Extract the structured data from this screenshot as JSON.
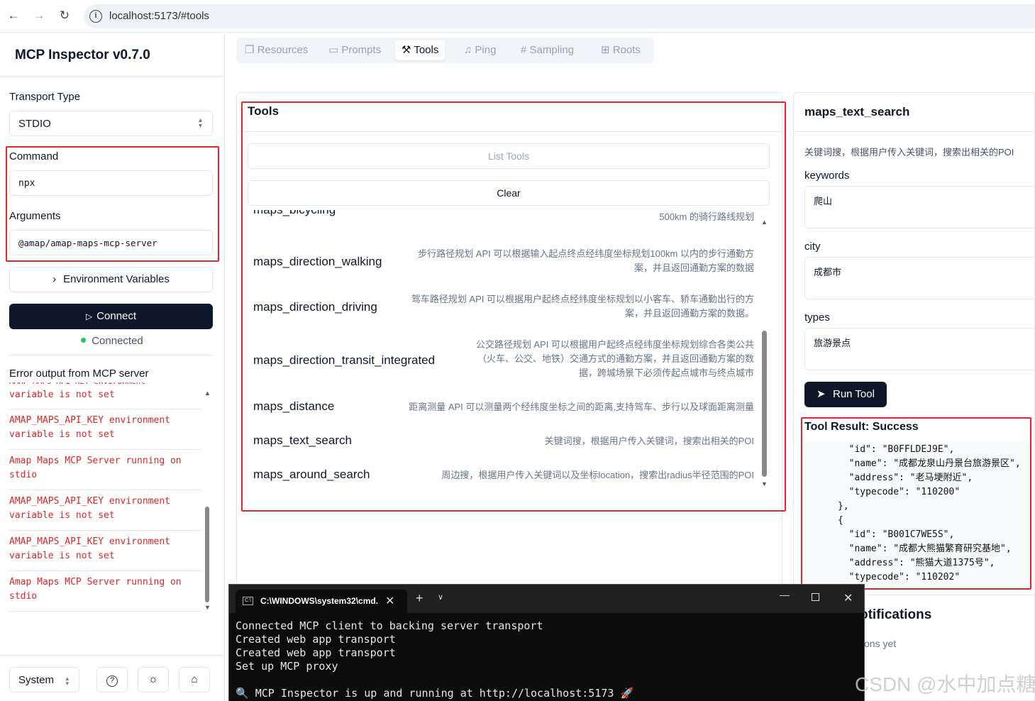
{
  "browser": {
    "url": "localhost:5173/#tools"
  },
  "sidebar": {
    "app_title": "MCP Inspector v0.7.0",
    "transport_label": "Transport Type",
    "transport_value": "STDIO",
    "command_label": "Command",
    "command_value": "npx",
    "arguments_label": "Arguments",
    "arguments_value": "@amap/amap-maps-mcp-server",
    "env_button": "Environment Variables",
    "connect_button": "Connect",
    "status": "Connected",
    "error_title": "Error output from MCP server",
    "errors": [
      "variable is not set",
      "AMAP_MAPS_API_KEY environment variable is not set",
      "Amap Maps MCP Server running on stdio",
      "AMAP_MAPS_API_KEY environment variable is not set",
      "AMAP_MAPS_API_KEY environment variable is not set",
      "Amap Maps MCP Server running on stdio"
    ],
    "theme_select": "System"
  },
  "tabs": [
    "Resources",
    "Prompts",
    "Tools",
    "Ping",
    "Sampling",
    "Roots"
  ],
  "tools_panel": {
    "title": "Tools",
    "list_button": "List Tools",
    "clear_button": "Clear",
    "tools": [
      {
        "name": "maps_bicycling",
        "desc": [
          "500km 的骑行路线规划"
        ]
      },
      {
        "name": "maps_direction_walking",
        "desc": [
          "步行路径规划 API 可以根据输入起点终点经纬度坐标规划100km 以内的步行通勤方",
          "案，并且返回通勤方案的数据"
        ]
      },
      {
        "name": "maps_direction_driving",
        "desc": [
          "驾车路径规划 API 可以根据用户起终点经纬度坐标规划以小客车、轿车通勤出行的方",
          "案，并且返回通勤方案的数据。"
        ]
      },
      {
        "name": "maps_direction_transit_integrated",
        "desc": [
          "公交路径规划 API 可以根据用户起终点经纬度坐标规划综合各类公共",
          "（火车、公交、地铁）交通方式的通勤方案，并且返回通勤方案的数",
          "据，跨城场景下必须传起点城市与终点城市"
        ]
      },
      {
        "name": "maps_distance",
        "desc": [
          "距离测量 API 可以测量两个经纬度坐标之间的距离,支持驾车、步行以及球面距离测量"
        ]
      },
      {
        "name": "maps_text_search",
        "desc": [
          "关键词搜，根据用户传入关键词，搜索出相关的POI"
        ]
      },
      {
        "name": "maps_around_search",
        "desc": [
          "周边搜，根据用户传入关键词以及坐标location，搜索出radius半径范围的POI"
        ]
      }
    ]
  },
  "detail_panel": {
    "tool_name": "maps_text_search",
    "description": "关键词搜，根据用户传入关键词，搜索出相关的POI",
    "fields": [
      {
        "label": "keywords",
        "value": "爬山"
      },
      {
        "label": "city",
        "value": "成都市"
      },
      {
        "label": "types",
        "value": "旅游景点"
      }
    ],
    "run_button": "Run Tool",
    "result_title": "Tool Result: Success",
    "result_lines": [
      "        \"id\": \"B0FFLDEJ9E\",",
      "        \"name\": \"成都龙泉山丹景台旅游景区\",",
      "        \"address\": \"老马埂附近\",",
      "        \"typecode\": \"110200\"",
      "      },",
      "      {",
      "        \"id\": \"B001C7WE5S\",",
      "        \"name\": \"成都大熊猫繁育研究基地\",",
      "        \"address\": \"熊猫大道1375号\",",
      "        \"typecode\": \"110202\""
    ],
    "notifications_title": "otifications",
    "notifications_empty": "ons yet"
  },
  "terminal": {
    "tab_title": "C:\\WINDOWS\\system32\\cmd.",
    "lines": [
      "Connected MCP client to backing server transport",
      "Created web app transport",
      "Created web app transport",
      "Set up MCP proxy",
      "",
      "🔍 MCP Inspector is up and running at http://localhost:5173 🚀"
    ]
  },
  "watermark": "CSDN @水中加点糖",
  "colors": {
    "accent": "#0f172a",
    "error": "#dc2626",
    "highlight": "#e8252a",
    "connected": "#22c55e"
  }
}
